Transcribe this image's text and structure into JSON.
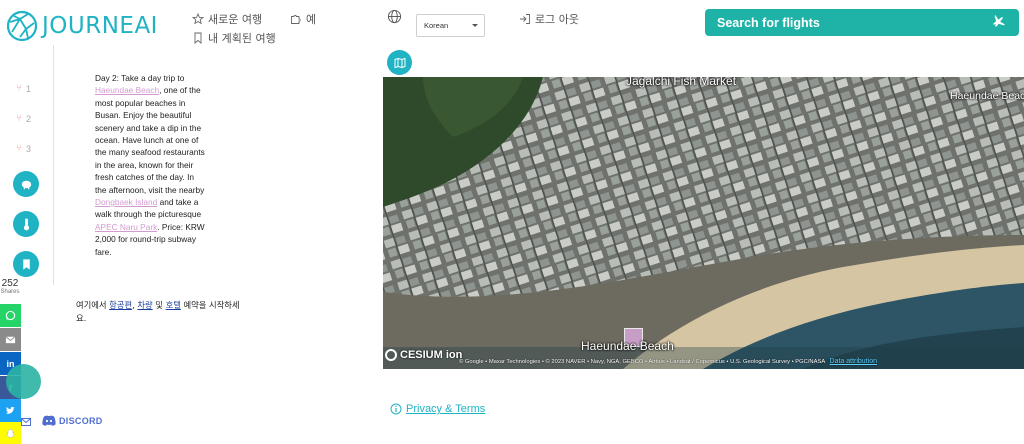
{
  "app": {
    "name": "JOURNEAI"
  },
  "header": {
    "new_trip": "새로운 여행",
    "my_trips": "내 계획된 여행",
    "example": "예",
    "language": {
      "selected": "Korean"
    },
    "logout": "로그 아웃",
    "search_flights": "Search for flights"
  },
  "sidebar": {
    "days": [
      {
        "label": "1"
      },
      {
        "label": "2"
      },
      {
        "label": "3"
      }
    ],
    "buttons": [
      {
        "icon": "piggy-bank-icon"
      },
      {
        "icon": "thermometer-icon"
      },
      {
        "icon": "bookmark-icon"
      }
    ]
  },
  "share": {
    "count": "252",
    "label": "Shares",
    "networks": [
      {
        "name": "whatsapp",
        "color": "#25d366"
      },
      {
        "name": "email",
        "color": "#8a8a8a"
      },
      {
        "name": "linkedin",
        "color": "#0a66c2"
      },
      {
        "name": "facebook",
        "color": "#3b5998"
      },
      {
        "name": "twitter",
        "color": "#1da1f2"
      },
      {
        "name": "snapchat",
        "color": "#fffc00"
      }
    ]
  },
  "community": {
    "discord": "DISCORD"
  },
  "itinerary": {
    "p1": "Day 2: Take a day trip to ",
    "poi1": "Haeundae Beach",
    "p2": ", one of the most popular beaches in Busan. Enjoy the beautiful scenery and take a dip in the ocean. Have lunch at one of the many seafood restaurants in the area, known for their fresh catches of the day. In the afternoon, visit the nearby ",
    "poi2": "Dongbaek Island",
    "p3": " and take a walk through the picturesque ",
    "poi3": "APEC Naru Park",
    "p4": ". Price: KRW 2,000 for round-trip subway fare."
  },
  "booking_note": {
    "prefix": "여기에서 ",
    "flights": "항공편",
    "car": "차량",
    "and": " 및 ",
    "hotel": "호텔",
    "suffix": " 예약을 시작하세요."
  },
  "map": {
    "labels": {
      "market": "Jagalchi Fish Market",
      "beach_ne": "Haeundae Beac",
      "beach_main": "Haeundae Beach"
    },
    "provider": "CESIUM ion",
    "attribution": "© Google • Maxar Technologies • © 2023 NAVER • Navy, NGA, GEBCO • Airbus • Landsat / Copernicus • U.S. Geological Survey • PGC/NASA",
    "attribution_link": "Data attribution"
  },
  "footer": {
    "privacy": "Privacy & Terms"
  },
  "colors": {
    "brand": "#1fb3c4",
    "search": "#1fb3a8",
    "poi": "#d39bd1"
  }
}
